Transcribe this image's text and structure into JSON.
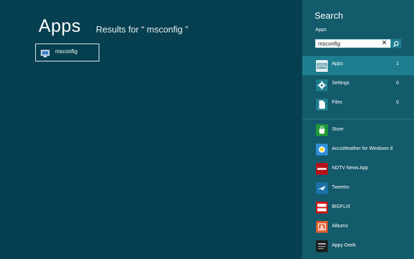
{
  "main": {
    "title": "Apps",
    "results_text": "Results for “ msconfig ”",
    "results": [
      {
        "label": "msconfig",
        "icon": "msconfig-computer-icon"
      }
    ]
  },
  "search_pane": {
    "title": "Search",
    "scope_label": "Apps",
    "query": "msconfig",
    "clear_icon": "close-icon",
    "search_icon": "search-icon",
    "categories": [
      {
        "label": "Apps",
        "count": "1",
        "icon": "keyboard-icon",
        "selected": true
      },
      {
        "label": "Settings",
        "count": "0",
        "icon": "gear-icon",
        "selected": false
      },
      {
        "label": "Files",
        "count": "0",
        "icon": "document-icon",
        "selected": false
      }
    ],
    "apps": [
      {
        "label": "Store",
        "icon": "store-bag-icon",
        "color": "#1f9b34"
      },
      {
        "label": "AccuWeather for Windows 8",
        "icon": "weather-sun-icon",
        "color": "#2f8fd8"
      },
      {
        "label": "NDTV News App",
        "icon": "ndtv-logo-icon",
        "color": "#b8111a"
      },
      {
        "label": "Tweetro",
        "icon": "bird-icon",
        "color": "#1b72a8"
      },
      {
        "label": "BIGFLIX",
        "icon": "bigflix-logo-icon",
        "color": "#d01616"
      },
      {
        "label": "Albums",
        "icon": "photo-album-icon",
        "color": "#e05a2b"
      },
      {
        "label": "Appy Geek",
        "icon": "appy-geek-logo-icon",
        "color": "#1c1c1c"
      }
    ],
    "colors": {
      "pane_bg": "#135a6b",
      "selected_bg": "#1e7e8f",
      "page_bg": "#063f4f"
    }
  }
}
